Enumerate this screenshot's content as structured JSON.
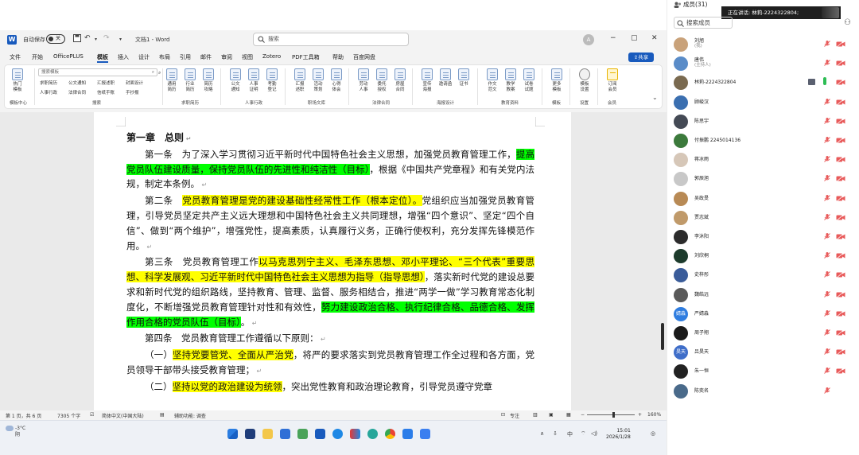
{
  "word": {
    "autosave_label": "自动保存",
    "autosave_state": "关",
    "doc_title": "文档1 - Word",
    "search_placeholder": "搜索",
    "account_initial": "A",
    "menu": [
      "文件",
      "开始",
      "OfficePLUS",
      "模板",
      "插入",
      "设计",
      "布局",
      "引用",
      "邮件",
      "审阅",
      "视图",
      "Zotero",
      "PDF工具箱",
      "帮助",
      "百度网盘"
    ],
    "active_menu": "模板",
    "share_label": "共享",
    "ribbon": {
      "hot_label": "热门\n模板",
      "template_search_placeholder": "搜索模板",
      "links_row1": [
        "求职简历",
        "公文通知",
        "汇报述职",
        "封面设计"
      ],
      "links_row2": [
        "人事行政",
        "法律合同",
        "信纸手账",
        "手抄报"
      ],
      "buttons": [
        {
          "label": "通用\n简历",
          "icon": "resume-icon"
        },
        {
          "label": "行业\n简历",
          "icon": "resume-icon"
        },
        {
          "label": "简历\n攻略",
          "icon": "resume-icon"
        },
        {
          "label": "公文\n通知",
          "icon": "document-icon"
        },
        {
          "label": "人事\n证明",
          "icon": "document-icon"
        },
        {
          "label": "考勤\n登记",
          "icon": "document-icon"
        },
        {
          "label": "汇报\n述职",
          "icon": "document-icon"
        },
        {
          "label": "活动\n策划",
          "icon": "document-icon"
        },
        {
          "label": "心得\n体会",
          "icon": "document-icon"
        },
        {
          "label": "劳动\n人事",
          "icon": "document-icon"
        },
        {
          "label": "委托\n授权",
          "icon": "document-icon"
        },
        {
          "label": "房屋\n合同",
          "icon": "document-icon"
        },
        {
          "label": "宣传\n海报",
          "icon": "poster-icon"
        },
        {
          "label": "邀请函",
          "icon": "poster-icon"
        },
        {
          "label": "证书",
          "icon": "poster-icon"
        },
        {
          "label": "作文\n范文",
          "icon": "document-icon"
        },
        {
          "label": "教学\n教案",
          "icon": "document-icon"
        },
        {
          "label": "试卷\n试题",
          "icon": "document-icon"
        },
        {
          "label": "更多\n模板",
          "icon": "document-icon"
        },
        {
          "label": "模板\n设置",
          "icon": "gear-icon"
        },
        {
          "label": "订阅\n会员",
          "icon": "crown-icon"
        }
      ],
      "groups": [
        "模板中心",
        "搜索",
        "求职简历",
        "人事行政",
        "职场文库",
        "法律合同",
        "海报设计",
        "教育资料",
        "模板",
        "设置",
        "会员"
      ]
    },
    "document": {
      "heading": "第一章　总则",
      "articles": [
        [
          {
            "t": "第一条　为了深入学习贯彻习近平新时代中国特色社会主义思想，加强党员教育管理工作，",
            "h": ""
          },
          {
            "t": "提高党员队伍建设质量，保持党员队伍的先进性和纯洁性（目标）",
            "h": "green"
          },
          {
            "t": "，根据《中国共产党章程》和有关党内法规，制定本条例。",
            "h": ""
          }
        ],
        [
          {
            "t": "第二条　",
            "h": ""
          },
          {
            "t": "党员教育管理是党的建设基础性经常性工作（根本定位）。",
            "h": "yellow"
          },
          {
            "t": "党组织应当加强党员教育管理，引导党员坚定共产主义远大理想和中国特色社会主义共同理想，增强“四个意识”、坚定“四个自信”、做到“两个维护”，增强党性，提高素质，认真履行义务，正确行使权利，充分发挥先锋模范作用。",
            "h": ""
          }
        ],
        [
          {
            "t": "第三条　党员教育管理工作",
            "h": ""
          },
          {
            "t": "以马克思列宁主义、毛泽东思想、邓小平理论、“三个代表”重要思想、科学发展观、习近平新时代中国特色社会主义思想为指导（指导思想）",
            "h": "yellow"
          },
          {
            "t": "，落实新时代党的建设总要求和新时代党的组织路线，坚持教育、管理、监督、服务相结合，推进“两学一做”学习教育常态化制度化，不断增强党员教育管理针对性和有效性，",
            "h": ""
          },
          {
            "t": "努力建设政治合格、执行纪律合格、品德合格、发挥作用合格的党员队伍（目标）",
            "h": "green"
          },
          {
            "t": "。",
            "h": ""
          }
        ],
        [
          {
            "t": "第四条　党员教育管理工作遵循以下原则：",
            "h": ""
          }
        ],
        [
          {
            "t": "（一）",
            "h": ""
          },
          {
            "t": "坚持党要管党、全面从严治党",
            "h": "yellow"
          },
          {
            "t": "，将严的要求落实到党员教育管理工作全过程和各方面，党员领导干部带头接受教育管理；",
            "h": ""
          }
        ],
        [
          {
            "t": "（二）",
            "h": ""
          },
          {
            "t": "坚持以党的政治建设为统领",
            "h": "yellow"
          },
          {
            "t": "，突出党性教育和政治理论教育，引导党员遵守党章",
            "h": ""
          }
        ]
      ]
    },
    "status": {
      "page": "第 1 页，共 6 页",
      "words": "7305 个字",
      "language": "简体中文(中国大陆)",
      "accessibility": "辅助功能: 调查",
      "focus": "专注",
      "zoom": "160%",
      "zoom_minus": "−",
      "zoom_plus": "+"
    },
    "taskbar": {
      "temp": "-3°C",
      "weather": "阴",
      "ime": "中",
      "time": "15:01",
      "date": "2026/1/28"
    }
  },
  "meeting": {
    "members_title": "成员(31)",
    "speaking_label": "正在讲话:",
    "speaking_name": "林莉-2224322804;",
    "search_placeholder": "搜索成员",
    "members": [
      {
        "name": "刘旭",
        "role": "(我)",
        "color": "#c9a27a",
        "screen": false,
        "mic_on": false
      },
      {
        "name": "唐伟",
        "role": "(主持人)",
        "color": "#5a8cc8",
        "screen": false,
        "mic_on": false
      },
      {
        "name": "林莉-2224322804",
        "role": "",
        "color": "#7a6a50",
        "screen": true,
        "mic_on": true
      },
      {
        "name": "顾峻汉",
        "role": "",
        "color": "#3b6fb0",
        "screen": false,
        "mic_on": false
      },
      {
        "name": "陈思宇",
        "role": "",
        "color": "#444a55",
        "screen": false,
        "mic_on": false
      },
      {
        "name": "付振鹏 2245014136",
        "role": "",
        "color": "#3c7a3c",
        "screen": false,
        "mic_on": false
      },
      {
        "name": "蒋冰雨",
        "role": "",
        "color": "#d6c7b8",
        "screen": false,
        "mic_on": false
      },
      {
        "name": "郭辰旭",
        "role": "",
        "color": "#c8c8c8",
        "screen": false,
        "mic_on": false
      },
      {
        "name": "吴政旻",
        "role": "",
        "color": "#b88a55",
        "screen": false,
        "mic_on": false
      },
      {
        "name": "贾志斌",
        "role": "",
        "color": "#c09a6a",
        "screen": false,
        "mic_on": false
      },
      {
        "name": "李沐阳",
        "role": "",
        "color": "#2c2c2c",
        "screen": false,
        "mic_on": false
      },
      {
        "name": "刘欣桐",
        "role": "",
        "color": "#1d3b2c",
        "screen": false,
        "mic_on": false
      },
      {
        "name": "史梓彤",
        "role": "",
        "color": "#3a5c9a",
        "screen": false,
        "mic_on": false
      },
      {
        "name": "魏皓远",
        "role": "",
        "color": "#5a5a5a",
        "screen": false,
        "mic_on": false
      },
      {
        "name": "严婧淼",
        "role": "",
        "color": "#2f7de0",
        "avatar_text": "婧淼",
        "screen": false,
        "mic_on": false
      },
      {
        "name": "周子翔",
        "role": "",
        "color": "#1a1a1a",
        "screen": false,
        "mic_on": false
      },
      {
        "name": "吕昊天",
        "role": "",
        "color": "#3f6ec9",
        "avatar_text": "昊天",
        "screen": false,
        "mic_on": false
      },
      {
        "name": "朱一恒",
        "role": "",
        "color": "#222222",
        "screen": false,
        "mic_on": false
      },
      {
        "name": "陈奕名",
        "role": "",
        "color": "#4a6a8a",
        "screen": false,
        "mic_on": false
      }
    ]
  }
}
